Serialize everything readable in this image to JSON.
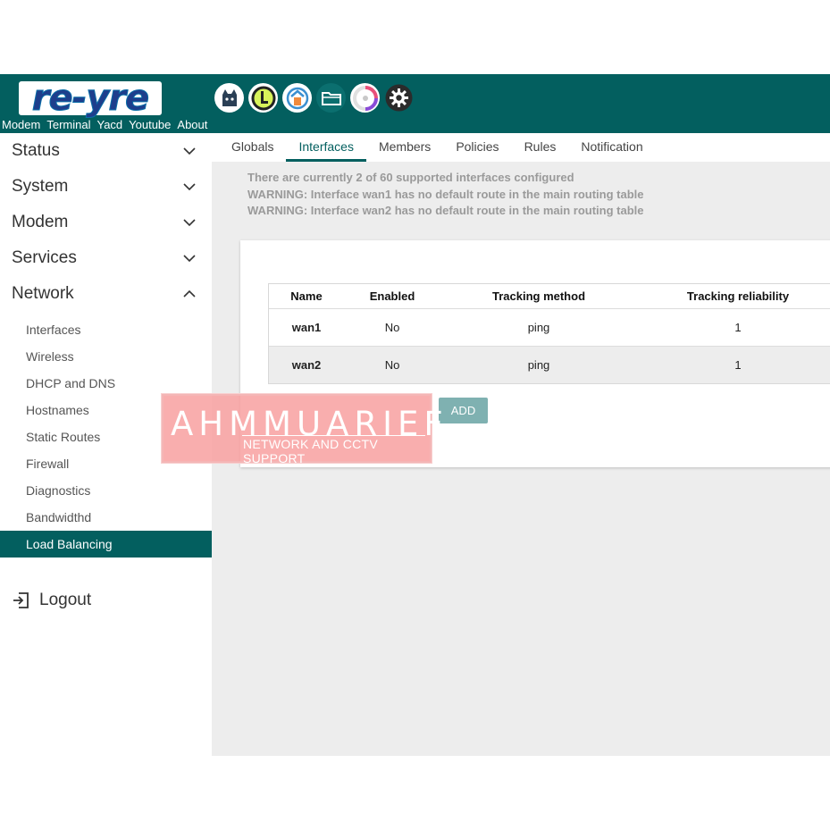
{
  "header": {
    "logo_text": "re-yre",
    "links": [
      "Modem",
      "Terminal",
      "Yacd",
      "Youtube",
      "About"
    ],
    "apps": [
      "cat-icon",
      "power-icon",
      "network-tool-icon",
      "folder-icon",
      "speedometer-icon",
      "gear-icon"
    ]
  },
  "sidebar": {
    "menus": [
      {
        "label": "Status",
        "expanded": false
      },
      {
        "label": "System",
        "expanded": false
      },
      {
        "label": "Modem",
        "expanded": false
      },
      {
        "label": "Services",
        "expanded": false
      },
      {
        "label": "Network",
        "expanded": true
      }
    ],
    "network_items": [
      "Interfaces",
      "Wireless",
      "DHCP and DNS",
      "Hostnames",
      "Static Routes",
      "Firewall",
      "Diagnostics",
      "Bandwidthd",
      "Load Balancing"
    ],
    "active_item": "Load Balancing",
    "logout_label": "Logout"
  },
  "tabs": [
    "Globals",
    "Interfaces",
    "Members",
    "Policies",
    "Rules",
    "Notification"
  ],
  "active_tab": "Interfaces",
  "notices": [
    "There are currently 2 of 60 supported interfaces configured",
    "WARNING: Interface wan1 has no default route in the main routing table",
    "WARNING: Interface wan2 has no default route in the main routing table"
  ],
  "table": {
    "columns": [
      "Name",
      "Enabled",
      "Tracking method",
      "Tracking reliability"
    ],
    "rows": [
      {
        "name": "wan1",
        "enabled": "No",
        "tracking_method": "ping",
        "reliability": "1"
      },
      {
        "name": "wan2",
        "enabled": "No",
        "tracking_method": "ping",
        "reliability": "1"
      }
    ]
  },
  "add_label": "ADD",
  "watermark": {
    "title": "AHMMUARIEF",
    "subtitle": "NETWORK AND CCTV SUPPORT"
  },
  "colors": {
    "brand": "#035f5f",
    "button": "#7fb1b1",
    "background": "#ededed"
  }
}
